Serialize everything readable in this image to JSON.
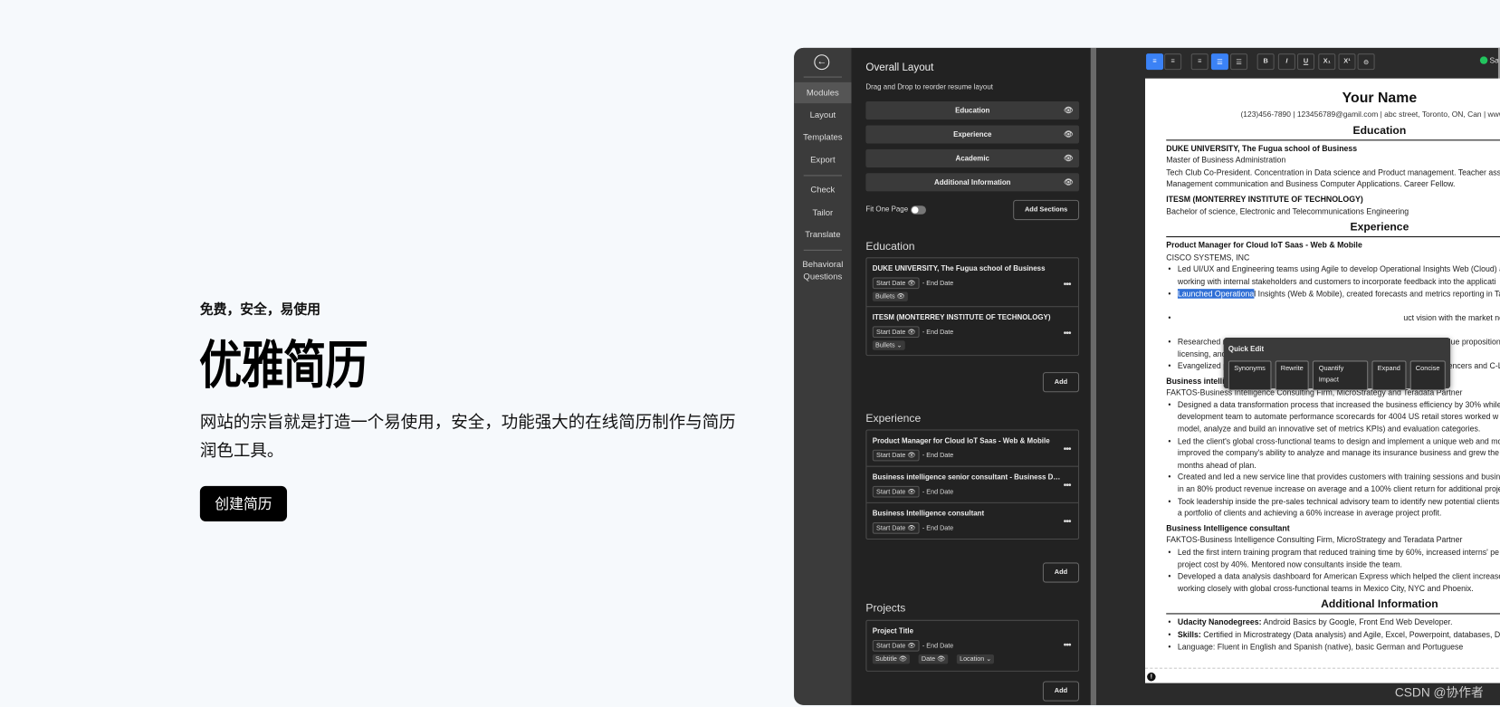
{
  "hero": {
    "subtitle": "免费，安全，易使用",
    "title": "优雅简历",
    "description": "网站的宗旨就是打造一个易使用，安全，功能强大的在线简历制作与简历润色工具。",
    "cta": "创建简历"
  },
  "sidebar": {
    "back_icon": "arrow-left-circle-icon",
    "items": [
      {
        "label": "Modules",
        "active": true
      },
      {
        "label": "Layout"
      },
      {
        "label": "Templates"
      },
      {
        "label": "Export"
      },
      {
        "label": "Check"
      },
      {
        "label": "Tailor"
      },
      {
        "label": "Translate"
      },
      {
        "label": "Behavioral Questions"
      }
    ]
  },
  "panel": {
    "overall_title": "Overall Layout",
    "overall_hint": "Drag and Drop to reorder resume layout",
    "layout_items": [
      "Education",
      "Experience",
      "Academic",
      "Additional Information"
    ],
    "fit_one_page": "Fit One Page",
    "add_sections": "Add Sections",
    "add": "Add",
    "start_date": "Start Date",
    "end_date": "- End Date",
    "education": {
      "title": "Education",
      "items": [
        {
          "title": "DUKE UNIVERSITY, The Fugua school of Business",
          "chip": "Bullets"
        },
        {
          "title": "ITESM (MONTERREY INSTITUTE OF TECHNOLOGY)",
          "chip": "Bullets"
        }
      ]
    },
    "experience": {
      "title": "Experience",
      "items": [
        {
          "title": "Product Manager for Cloud IoT Saas - Web & Mobile"
        },
        {
          "title": "Business intelligence senior consultant - Business Development"
        },
        {
          "title": "Business Intelligence consultant"
        }
      ]
    },
    "projects": {
      "title": "Projects",
      "items": [
        {
          "title": "Project Title",
          "chips": [
            "Subtitle",
            "Date",
            "Location"
          ]
        }
      ]
    }
  },
  "toolbar": {
    "buttons": [
      "align-left",
      "align-justify",
      "align-right",
      "list-bullet",
      "list-numbered",
      "B",
      "I",
      "U",
      "X₁",
      "X¹",
      "link"
    ],
    "status": "Sav",
    "accent": "#3b82f6"
  },
  "resume": {
    "name": "Your Name",
    "contact": "(123)456-7890 | 123456789@gamil.com | abc street, Toronto, ON, Can | www.you",
    "education_header": "Education",
    "edu": [
      {
        "bold": "DUKE UNIVERSITY, The Fugua school of Business"
      },
      {
        "text": "Master of Business Administration"
      },
      {
        "text": "Tech Club Co-President. Concentration in Data science and Product management. Teacher assis"
      },
      {
        "text": "Management communication and Business Computer Applications. Career Fellow."
      },
      {
        "bold": "ITESM (MONTERREY INSTITUTE OF TECHNOLOGY)"
      },
      {
        "text": "Bachelor of science, Electronic and Telecommunications Engineering"
      }
    ],
    "experience_header": "Experience",
    "job1_title": "Product Manager for Cloud IoT Saas - Web & Mobile",
    "job1_company": "CISCO SYSTEMS, INC",
    "job1_b1a": "Led UI/UX and Engineering teams using Agile to develop Operational Insights Web (Cloud) a",
    "job1_b1b": "working with internal stakeholders and customers to incorporate feedback into the applicati",
    "job1_b2_hl": "Launched Operationa",
    "job1_b2_rest": "l Insights (Web & Mobile), created forecasts and metrics reporting in Ta",
    "job1_b3_frag": "uct vision with the market ne",
    "job1_b4a": "Researched market opportunities and defined customer segmentation and value proposition",
    "job1_b4b": "licensing, and marketing and sales content.",
    "job1_b5": "Evangelized products in road shows, Cisco live events with social media influencers and C-Le",
    "job2_title": "Business intelligence senior consultant - Business Development",
    "job2_company": "FAKTOS-Business Intelligence Consulting Firm, MicroStrategy and Teradata Partner",
    "job2_lines": [
      {
        "s": true,
        "t": "Designed a data transformation process that increased the business efficiency by 30% while"
      },
      {
        "t": "development team to automate performance scorecards for 4004 US retail stores worked w"
      },
      {
        "t": "model, analyze and build an innovative set of metrics KPIs) and evaluation categories."
      },
      {
        "s": true,
        "t": "Led the client's global cross-functional teams to design and implement a unique web and mob"
      },
      {
        "t": "improved the company's ability to analyze and manage its insurance business and grew the u"
      },
      {
        "t": "months ahead of plan."
      },
      {
        "s": true,
        "t": "Created and led a new service line that provides customers with training sessions and busine"
      },
      {
        "t": "in an 80% product revenue increase on average and a 100% client return for additional proje"
      },
      {
        "s": true,
        "t": "Took leadership inside the pre-sales technical advisory team to identify new potential clients"
      },
      {
        "t": "a portfolio of clients and achieving a 60% increase in average project profit."
      }
    ],
    "job3_title": "Business Intelligence consultant",
    "job3_company": "FAKTOS-Business Intelligence Consulting Firm, MicroStrategy and Teradata Partner",
    "job3_lines": [
      {
        "s": true,
        "t": "Led the first intern training program that reduced training time by 60%, increased interns' pe"
      },
      {
        "t": "project cost by 40%. Mentored now consultants inside the team."
      },
      {
        "s": true,
        "t": "Developed a data analysis dashboard for American Express which helped the client increase"
      },
      {
        "t": "working closely with global cross-functional teams in Mexico City, NYC and Phoenix."
      }
    ],
    "additional_header": "Additional Information",
    "additional": [
      {
        "bold": "Udacity Nanodegrees:",
        "t": " Android Basics by Google, Front End Web Developer."
      },
      {
        "bold": "Skills:",
        "t": " Certified in Microstrategy (Data analysis) and Agile, Excel, Powerpoint, databases, Dat"
      },
      {
        "bold": "",
        "t": "Language: Fluent in English and Spanish (native), basic German and Portuguese"
      }
    ]
  },
  "quick_edit": {
    "title": "Quick Edit",
    "buttons": [
      "Synonyms",
      "Rewrite",
      "Quantify Impact",
      "Expand",
      "Concise"
    ]
  },
  "watermark": "CSDN @协作者"
}
